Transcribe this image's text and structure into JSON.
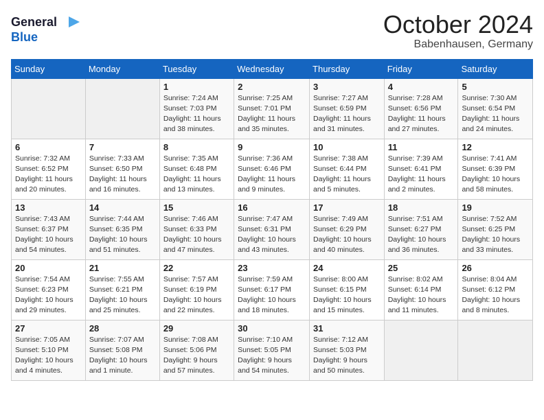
{
  "header": {
    "logo_line1": "General",
    "logo_line2": "Blue",
    "month": "October 2024",
    "location": "Babenhausen, Germany"
  },
  "columns": [
    "Sunday",
    "Monday",
    "Tuesday",
    "Wednesday",
    "Thursday",
    "Friday",
    "Saturday"
  ],
  "weeks": [
    [
      {
        "day": "",
        "info": ""
      },
      {
        "day": "",
        "info": ""
      },
      {
        "day": "1",
        "info": "Sunrise: 7:24 AM\nSunset: 7:03 PM\nDaylight: 11 hours and 38 minutes."
      },
      {
        "day": "2",
        "info": "Sunrise: 7:25 AM\nSunset: 7:01 PM\nDaylight: 11 hours and 35 minutes."
      },
      {
        "day": "3",
        "info": "Sunrise: 7:27 AM\nSunset: 6:59 PM\nDaylight: 11 hours and 31 minutes."
      },
      {
        "day": "4",
        "info": "Sunrise: 7:28 AM\nSunset: 6:56 PM\nDaylight: 11 hours and 27 minutes."
      },
      {
        "day": "5",
        "info": "Sunrise: 7:30 AM\nSunset: 6:54 PM\nDaylight: 11 hours and 24 minutes."
      }
    ],
    [
      {
        "day": "6",
        "info": "Sunrise: 7:32 AM\nSunset: 6:52 PM\nDaylight: 11 hours and 20 minutes."
      },
      {
        "day": "7",
        "info": "Sunrise: 7:33 AM\nSunset: 6:50 PM\nDaylight: 11 hours and 16 minutes."
      },
      {
        "day": "8",
        "info": "Sunrise: 7:35 AM\nSunset: 6:48 PM\nDaylight: 11 hours and 13 minutes."
      },
      {
        "day": "9",
        "info": "Sunrise: 7:36 AM\nSunset: 6:46 PM\nDaylight: 11 hours and 9 minutes."
      },
      {
        "day": "10",
        "info": "Sunrise: 7:38 AM\nSunset: 6:44 PM\nDaylight: 11 hours and 5 minutes."
      },
      {
        "day": "11",
        "info": "Sunrise: 7:39 AM\nSunset: 6:41 PM\nDaylight: 11 hours and 2 minutes."
      },
      {
        "day": "12",
        "info": "Sunrise: 7:41 AM\nSunset: 6:39 PM\nDaylight: 10 hours and 58 minutes."
      }
    ],
    [
      {
        "day": "13",
        "info": "Sunrise: 7:43 AM\nSunset: 6:37 PM\nDaylight: 10 hours and 54 minutes."
      },
      {
        "day": "14",
        "info": "Sunrise: 7:44 AM\nSunset: 6:35 PM\nDaylight: 10 hours and 51 minutes."
      },
      {
        "day": "15",
        "info": "Sunrise: 7:46 AM\nSunset: 6:33 PM\nDaylight: 10 hours and 47 minutes."
      },
      {
        "day": "16",
        "info": "Sunrise: 7:47 AM\nSunset: 6:31 PM\nDaylight: 10 hours and 43 minutes."
      },
      {
        "day": "17",
        "info": "Sunrise: 7:49 AM\nSunset: 6:29 PM\nDaylight: 10 hours and 40 minutes."
      },
      {
        "day": "18",
        "info": "Sunrise: 7:51 AM\nSunset: 6:27 PM\nDaylight: 10 hours and 36 minutes."
      },
      {
        "day": "19",
        "info": "Sunrise: 7:52 AM\nSunset: 6:25 PM\nDaylight: 10 hours and 33 minutes."
      }
    ],
    [
      {
        "day": "20",
        "info": "Sunrise: 7:54 AM\nSunset: 6:23 PM\nDaylight: 10 hours and 29 minutes."
      },
      {
        "day": "21",
        "info": "Sunrise: 7:55 AM\nSunset: 6:21 PM\nDaylight: 10 hours and 25 minutes."
      },
      {
        "day": "22",
        "info": "Sunrise: 7:57 AM\nSunset: 6:19 PM\nDaylight: 10 hours and 22 minutes."
      },
      {
        "day": "23",
        "info": "Sunrise: 7:59 AM\nSunset: 6:17 PM\nDaylight: 10 hours and 18 minutes."
      },
      {
        "day": "24",
        "info": "Sunrise: 8:00 AM\nSunset: 6:15 PM\nDaylight: 10 hours and 15 minutes."
      },
      {
        "day": "25",
        "info": "Sunrise: 8:02 AM\nSunset: 6:14 PM\nDaylight: 10 hours and 11 minutes."
      },
      {
        "day": "26",
        "info": "Sunrise: 8:04 AM\nSunset: 6:12 PM\nDaylight: 10 hours and 8 minutes."
      }
    ],
    [
      {
        "day": "27",
        "info": "Sunrise: 7:05 AM\nSunset: 5:10 PM\nDaylight: 10 hours and 4 minutes."
      },
      {
        "day": "28",
        "info": "Sunrise: 7:07 AM\nSunset: 5:08 PM\nDaylight: 10 hours and 1 minute."
      },
      {
        "day": "29",
        "info": "Sunrise: 7:08 AM\nSunset: 5:06 PM\nDaylight: 9 hours and 57 minutes."
      },
      {
        "day": "30",
        "info": "Sunrise: 7:10 AM\nSunset: 5:05 PM\nDaylight: 9 hours and 54 minutes."
      },
      {
        "day": "31",
        "info": "Sunrise: 7:12 AM\nSunset: 5:03 PM\nDaylight: 9 hours and 50 minutes."
      },
      {
        "day": "",
        "info": ""
      },
      {
        "day": "",
        "info": ""
      }
    ]
  ]
}
